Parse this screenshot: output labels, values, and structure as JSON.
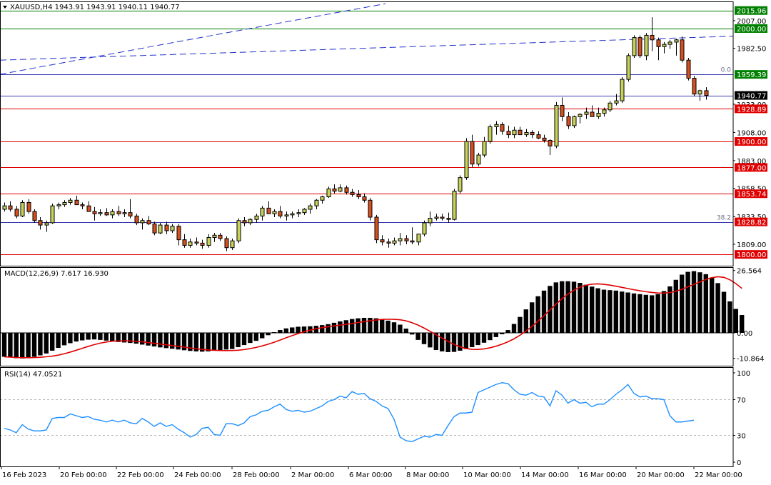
{
  "header": {
    "symbol_text": "XAUUSD,H4  1943.91 1943.91 1940.11 1940.77",
    "macd_text": "MACD(12,26,9) 7.617 16.930",
    "rsi_text": "RSI(14) 47.0521"
  },
  "colors": {
    "bull": "#c8d25a",
    "bear": "#d4501e",
    "wick": "#000000",
    "hline_red": "#e00000",
    "hline_green": "#008000",
    "hline_navy": "#3a3ab0",
    "trend_blue": "#2233cc",
    "macd_hist": "#000000",
    "macd_signal": "#e00000",
    "rsi_line": "#1e90ff",
    "tag_red": "#e00000",
    "tag_green": "#008000",
    "tag_black": "#000000"
  },
  "chart_data": [
    {
      "type": "candlestick",
      "symbol": "XAUUSD",
      "timeframe": "H4",
      "ylim": [
        1790,
        2024
      ],
      "y_ticks": [
        "2007.00",
        "1982.50",
        "1933.00",
        "1908.00",
        "1883.00",
        "1858.50",
        "1833.50",
        "1809.00"
      ],
      "x_labels": [
        "16 Feb 2023",
        "20 Feb 00:00",
        "22 Feb 00:00",
        "24 Feb 00:00",
        "28 Feb 00:00",
        "2 Mar 00:00",
        "6 Mar 00:00",
        "8 Mar 00:00",
        "10 Mar 00:00",
        "14 Mar 00:00",
        "16 Mar 00:00",
        "20 Mar 00:00",
        "22 Mar 00:00"
      ],
      "level_lines": [
        {
          "price": 2015.96,
          "label": "2015.96",
          "style": "green"
        },
        {
          "price": 2000.0,
          "label": "2000.00",
          "style": "green"
        },
        {
          "price": 1959.39,
          "label": "1959.39",
          "style": "navy",
          "tag_color": "green",
          "fib_text": "0.0"
        },
        {
          "price": 1940.77,
          "label": "1940.77",
          "style": "navy",
          "tag_color": "black"
        },
        {
          "price": 1928.89,
          "label": "1928.89",
          "style": "red"
        },
        {
          "price": 1900.0,
          "label": "1900.00",
          "style": "red"
        },
        {
          "price": 1877.0,
          "label": "1877.00",
          "style": "red"
        },
        {
          "price": 1853.74,
          "label": "1853.74",
          "style": "red"
        },
        {
          "price": 1828.82,
          "label": "1828.82",
          "style": "navy",
          "tag_color": "red",
          "fib_text": "38.2"
        },
        {
          "price": 1800.0,
          "label": "1800.00",
          "style": "red"
        }
      ],
      "trendlines": [
        {
          "from": [
            0,
            1972.0
          ],
          "to": [
            1030,
            1993.3
          ]
        },
        {
          "from": [
            0,
            1959.5
          ],
          "to": [
            540,
            2022.0
          ]
        }
      ],
      "candles": [
        [
          1840,
          1846,
          1838,
          1843
        ],
        [
          1843,
          1847,
          1838,
          1840
        ],
        [
          1840,
          1843,
          1832,
          1834
        ],
        [
          1834,
          1848,
          1833,
          1846
        ],
        [
          1846,
          1849,
          1836,
          1838
        ],
        [
          1838,
          1840,
          1828,
          1830
        ],
        [
          1830,
          1833,
          1822,
          1826
        ],
        [
          1826,
          1830,
          1820,
          1828
        ],
        [
          1828,
          1845,
          1827,
          1843
        ],
        [
          1843,
          1846,
          1840,
          1844
        ],
        [
          1844,
          1848,
          1842,
          1846
        ],
        [
          1846,
          1850,
          1844,
          1848
        ],
        [
          1848,
          1852,
          1846,
          1844
        ],
        [
          1844,
          1846,
          1840,
          1843
        ],
        [
          1843,
          1847,
          1840,
          1838
        ],
        [
          1838,
          1842,
          1830,
          1836
        ],
        [
          1836,
          1840,
          1834,
          1837
        ],
        [
          1837,
          1841,
          1834,
          1835
        ],
        [
          1835,
          1840,
          1832,
          1838
        ],
        [
          1838,
          1843,
          1834,
          1836
        ],
        [
          1836,
          1840,
          1833,
          1837
        ],
        [
          1837,
          1849,
          1832,
          1834
        ],
        [
          1834,
          1836,
          1826,
          1828
        ],
        [
          1828,
          1832,
          1822,
          1830
        ],
        [
          1830,
          1834,
          1826,
          1827
        ],
        [
          1827,
          1829,
          1817,
          1819
        ],
        [
          1819,
          1828,
          1818,
          1826
        ],
        [
          1826,
          1829,
          1818,
          1821
        ],
        [
          1821,
          1827,
          1819,
          1825
        ],
        [
          1825,
          1827,
          1808,
          1813
        ],
        [
          1813,
          1818,
          1806,
          1808
        ],
        [
          1808,
          1814,
          1806,
          1811
        ],
        [
          1811,
          1815,
          1808,
          1810
        ],
        [
          1810,
          1813,
          1805,
          1808
        ],
        [
          1808,
          1818,
          1806,
          1815
        ],
        [
          1815,
          1819,
          1811,
          1817
        ],
        [
          1817,
          1819,
          1812,
          1814
        ],
        [
          1814,
          1816,
          1803,
          1806
        ],
        [
          1806,
          1814,
          1804,
          1812
        ],
        [
          1812,
          1832,
          1810,
          1830
        ],
        [
          1830,
          1833,
          1825,
          1828
        ],
        [
          1828,
          1832,
          1826,
          1831
        ],
        [
          1831,
          1836,
          1828,
          1834
        ],
        [
          1834,
          1843,
          1830,
          1841
        ],
        [
          1841,
          1847,
          1838,
          1836
        ],
        [
          1836,
          1840,
          1833,
          1838
        ],
        [
          1838,
          1843,
          1832,
          1834
        ],
        [
          1834,
          1838,
          1830,
          1835
        ],
        [
          1835,
          1838,
          1832,
          1836
        ],
        [
          1836,
          1840,
          1833,
          1837
        ],
        [
          1837,
          1841,
          1835,
          1840
        ],
        [
          1840,
          1845,
          1836,
          1843
        ],
        [
          1843,
          1849,
          1840,
          1848
        ],
        [
          1848,
          1852,
          1845,
          1851
        ],
        [
          1851,
          1860,
          1850,
          1858
        ],
        [
          1858,
          1862,
          1854,
          1856
        ],
        [
          1856,
          1862,
          1855,
          1859
        ],
        [
          1859,
          1861,
          1853,
          1855
        ],
        [
          1855,
          1858,
          1851,
          1853
        ],
        [
          1853,
          1857,
          1849,
          1851
        ],
        [
          1851,
          1854,
          1846,
          1848
        ],
        [
          1848,
          1850,
          1830,
          1833
        ],
        [
          1833,
          1835,
          1810,
          1813
        ],
        [
          1813,
          1817,
          1808,
          1811
        ],
        [
          1811,
          1814,
          1806,
          1810
        ],
        [
          1810,
          1815,
          1808,
          1812
        ],
        [
          1812,
          1819,
          1808,
          1814
        ],
        [
          1814,
          1817,
          1809,
          1812
        ],
        [
          1812,
          1824,
          1809,
          1811
        ],
        [
          1811,
          1816,
          1808,
          1818
        ],
        [
          1818,
          1830,
          1816,
          1828
        ],
        [
          1828,
          1838,
          1825,
          1832
        ],
        [
          1832,
          1836,
          1830,
          1833
        ],
        [
          1833,
          1836,
          1830,
          1832
        ],
        [
          1832,
          1837,
          1828,
          1831
        ],
        [
          1831,
          1858,
          1830,
          1856
        ],
        [
          1856,
          1870,
          1854,
          1868
        ],
        [
          1868,
          1903,
          1866,
          1900
        ],
        [
          1900,
          1906,
          1877,
          1880
        ],
        [
          1880,
          1890,
          1878,
          1888
        ],
        [
          1888,
          1904,
          1886,
          1900
        ],
        [
          1900,
          1915,
          1898,
          1913
        ],
        [
          1913,
          1918,
          1906,
          1915
        ],
        [
          1915,
          1917,
          1906,
          1909
        ],
        [
          1909,
          1914,
          1903,
          1906
        ],
        [
          1906,
          1913,
          1903,
          1910
        ],
        [
          1910,
          1913,
          1906,
          1906
        ],
        [
          1906,
          1911,
          1904,
          1908
        ],
        [
          1908,
          1910,
          1903,
          1906
        ],
        [
          1906,
          1909,
          1902,
          1903
        ],
        [
          1903,
          1906,
          1899,
          1901
        ],
        [
          1901,
          1902,
          1888,
          1896
        ],
        [
          1896,
          1935,
          1894,
          1932
        ],
        [
          1932,
          1939,
          1918,
          1922
        ],
        [
          1922,
          1926,
          1911,
          1914
        ],
        [
          1914,
          1923,
          1912,
          1922
        ],
        [
          1922,
          1925,
          1916,
          1924
        ],
        [
          1924,
          1930,
          1920,
          1926
        ],
        [
          1926,
          1932,
          1922,
          1922
        ],
        [
          1922,
          1930,
          1920,
          1925
        ],
        [
          1925,
          1930,
          1922,
          1928
        ],
        [
          1928,
          1936,
          1926,
          1934
        ],
        [
          1934,
          1942,
          1932,
          1936
        ],
        [
          1936,
          1957,
          1934,
          1955
        ],
        [
          1955,
          1978,
          1953,
          1976
        ],
        [
          1976,
          1994,
          1974,
          1992
        ],
        [
          1992,
          1994,
          1974,
          1976
        ],
        [
          1976,
          1996,
          1972,
          1994
        ],
        [
          1994,
          2010,
          1980,
          1990
        ],
        [
          1990,
          1992,
          1972,
          1984
        ],
        [
          1984,
          1988,
          1978,
          1986
        ],
        [
          1986,
          1990,
          1982,
          1988
        ],
        [
          1988,
          1991,
          1976,
          1990
        ],
        [
          1990,
          1993,
          1970,
          1972
        ],
        [
          1972,
          1974,
          1954,
          1956
        ],
        [
          1956,
          1958,
          1940,
          1942
        ],
        [
          1942,
          1946,
          1936,
          1945
        ],
        [
          1945,
          1948,
          1937,
          1940.77
        ]
      ]
    },
    {
      "type": "bar",
      "name": "MACD(12,26,9)",
      "ylim": [
        -14,
        28
      ],
      "y_ticks": [
        "26.564",
        "0.00",
        "-10.864"
      ],
      "values": [
        -10.2,
        -10.5,
        -10.8,
        -10.9,
        -10.6,
        -10.2,
        -9.6,
        -8.8,
        -7.6,
        -6.4,
        -5.3,
        -4.4,
        -3.7,
        -3.2,
        -2.9,
        -2.8,
        -3.0,
        -3.3,
        -3.6,
        -3.9,
        -4.1,
        -4.3,
        -4.6,
        -5.0,
        -5.4,
        -5.8,
        -6.2,
        -6.5,
        -6.8,
        -7.1,
        -7.4,
        -7.7,
        -7.9,
        -8.0,
        -7.9,
        -7.6,
        -7.3,
        -7.1,
        -6.9,
        -6.1,
        -5.2,
        -4.3,
        -3.4,
        -2.3,
        -1.0,
        0.3,
        1.2,
        1.9,
        2.3,
        2.6,
        2.7,
        2.8,
        3.0,
        3.3,
        3.7,
        4.3,
        4.9,
        5.4,
        5.9,
        6.2,
        6.4,
        6.4,
        6.2,
        5.8,
        5.2,
        4.5,
        3.5,
        1.8,
        -0.7,
        -3.0,
        -4.8,
        -6.2,
        -7.3,
        -7.9,
        -8.2,
        -8.1,
        -7.6,
        -6.9,
        -6.1,
        -5.2,
        -4.2,
        -3.1,
        -1.8,
        -0.6,
        1.2,
        3.8,
        6.8,
        10.0,
        13.0,
        15.6,
        18.0,
        20.0,
        21.5,
        22.0,
        22.0,
        21.8,
        21.3,
        20.5,
        19.7,
        19.0,
        18.4,
        18.2,
        18.0,
        17.6,
        17.2,
        16.8,
        16.5,
        16.2,
        16.0,
        16.5,
        17.8,
        19.8,
        22.6,
        24.8,
        26.0,
        26.3,
        25.8,
        25.0,
        23.6,
        21.2,
        17.5,
        13.4,
        10.2,
        7.6
      ]
    },
    {
      "type": "line",
      "name": "RSI(14)",
      "ylim": [
        0,
        100
      ],
      "y_ticks": [
        "100",
        "70",
        "30",
        "0"
      ],
      "levels": [
        70,
        30
      ],
      "values": [
        38,
        36,
        33,
        42,
        37,
        35,
        35,
        36,
        49,
        50,
        50,
        54,
        52,
        50,
        51,
        48,
        47,
        45,
        47,
        45,
        47,
        44,
        43,
        49,
        45,
        40,
        44,
        40,
        42,
        37,
        33,
        28,
        31,
        38,
        39,
        31,
        30,
        43,
        43,
        41,
        44,
        51,
        53,
        57,
        58,
        62,
        65,
        59,
        57,
        58,
        56,
        57,
        60,
        63,
        68,
        70,
        74,
        72,
        79,
        76,
        77,
        71,
        68,
        63,
        60,
        48,
        28,
        24,
        23,
        26,
        29,
        28,
        31,
        30,
        41,
        51,
        55,
        55,
        56,
        78,
        81,
        84,
        87,
        89,
        88,
        81,
        76,
        75,
        78,
        74,
        73,
        63,
        80,
        75,
        66,
        70,
        66,
        67,
        62,
        65,
        65,
        70,
        76,
        81,
        87,
        77,
        73,
        74,
        71,
        71,
        70,
        52,
        45,
        45,
        46,
        47
      ]
    }
  ]
}
